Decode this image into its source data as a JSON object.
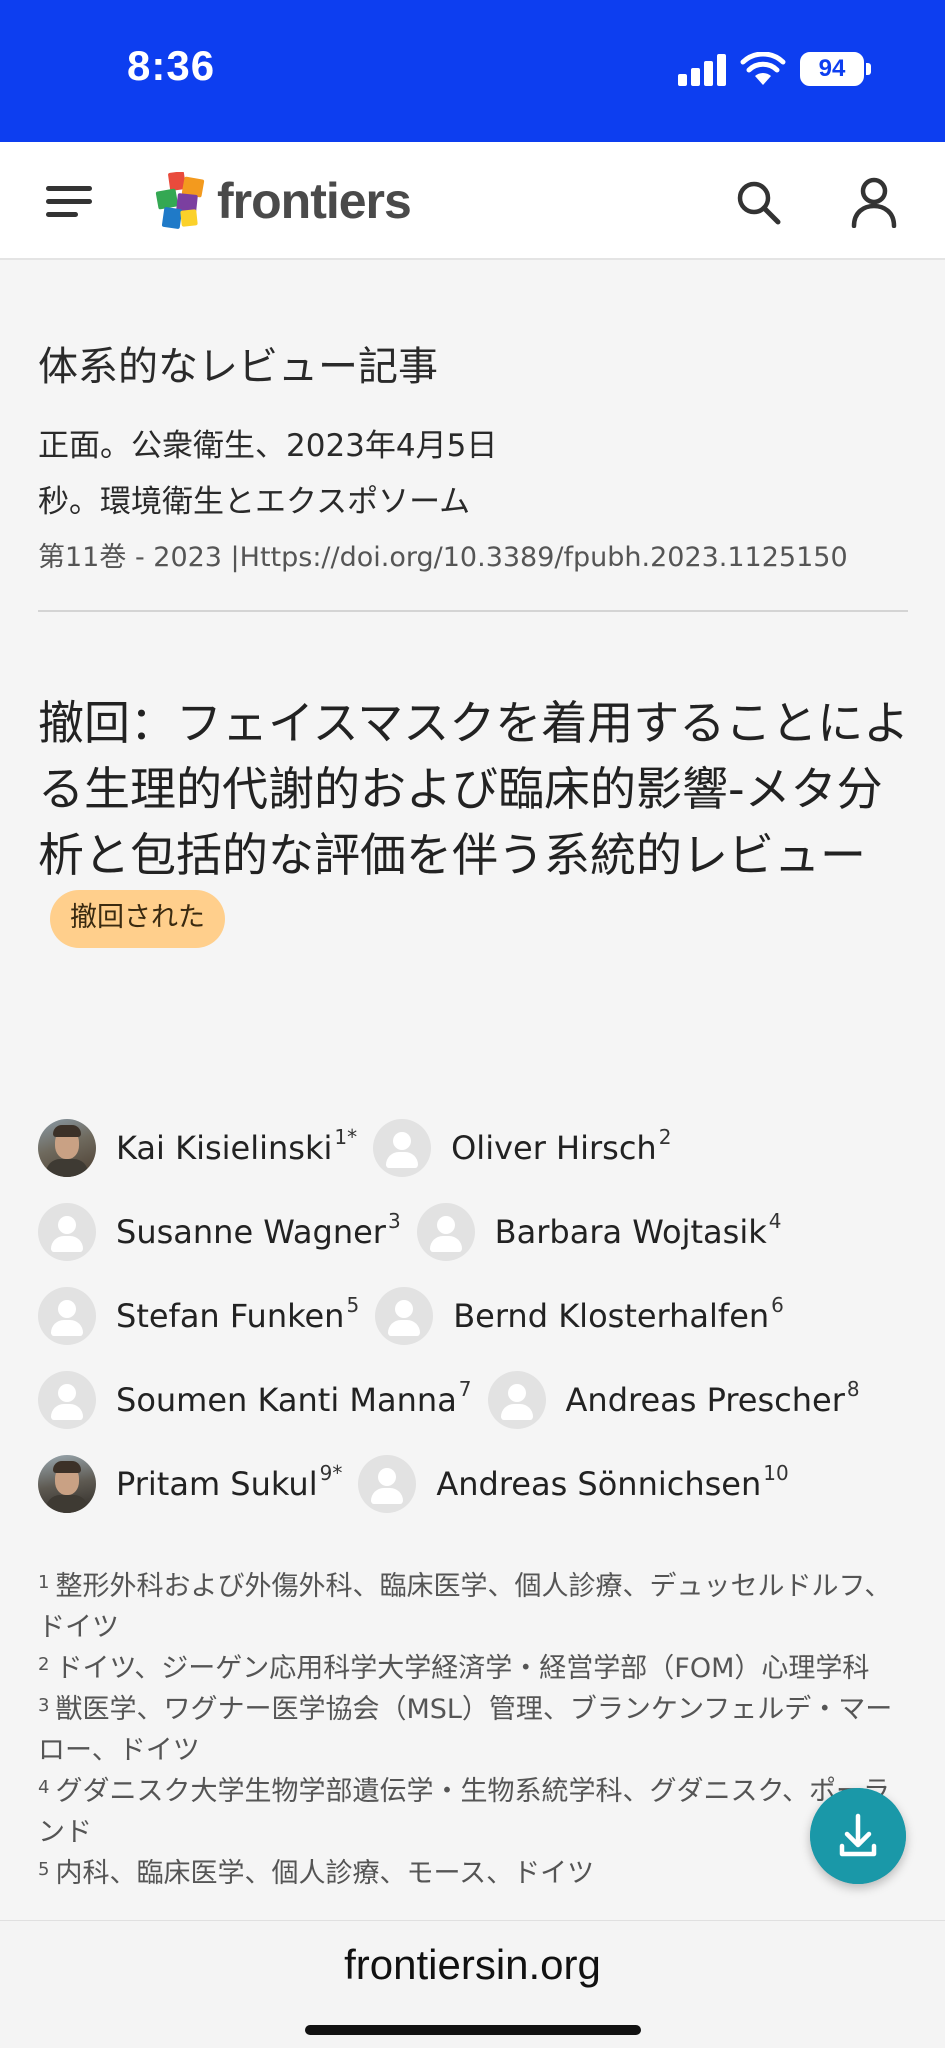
{
  "status_bar": {
    "time": "8:36",
    "battery": "94",
    "signal_icon": "cellular-signal-icon",
    "wifi_icon": "wifi-icon"
  },
  "header": {
    "logo_text": "frontiers",
    "menu_icon": "hamburger-menu-icon",
    "search_icon": "search-icon",
    "account_icon": "user-icon"
  },
  "article": {
    "type": "体系的なレビュー記事",
    "journal_line1": "正面。公衆衛生、2023年4月5日",
    "journal_line2": "秒。環境衛生とエクスポソーム",
    "doi_line": "第11巻 - 2023 |Https://doi.org/10.3389/fpubh.2023.1125150",
    "title": "撤回：フェイスマスクを着用することによる生理的代謝的および臨床的影響-メタ分析と包括的な評価を伴う系統的レビュー",
    "badge": "撤回された"
  },
  "authors": [
    [
      {
        "name": "Kai Kisielinski",
        "sup": "1*",
        "photo": true
      },
      {
        "name": "Oliver Hirsch",
        "sup": "2",
        "photo": false
      }
    ],
    [
      {
        "name": "Susanne Wagner",
        "sup": "3",
        "photo": false
      },
      {
        "name": "Barbara Wojtasik",
        "sup": "4",
        "photo": false
      }
    ],
    [
      {
        "name": "Stefan Funken",
        "sup": "5",
        "photo": false
      },
      {
        "name": "Bernd Klosterhalfen",
        "sup": "6",
        "photo": false
      }
    ],
    [
      {
        "name": "Soumen Kanti Manna",
        "sup": "7",
        "photo": false
      },
      {
        "name": "Andreas Prescher",
        "sup": "8",
        "photo": false
      }
    ],
    [
      {
        "name": "Pritam Sukul",
        "sup": "9*",
        "photo": true
      },
      {
        "name": "Andreas Sönnichsen",
        "sup": "10",
        "photo": false
      }
    ]
  ],
  "affiliations": [
    {
      "num": "1",
      "text": "整形外科および外傷外科、臨床医学、個人診療、デュッセルドルフ、ドイツ"
    },
    {
      "num": "2",
      "text": "ドイツ、ジーゲン応用科学大学経済学・経営学部（FOM）心理学科"
    },
    {
      "num": "3",
      "text": "獣医学、ワグナー医学協会（MSL）管理、ブランケンフェルデ・マーロー、ドイツ"
    },
    {
      "num": "4",
      "text": "グダニスク大学生物学部遺伝学・生物系統学科、グダニスク、ポーランド"
    },
    {
      "num": "5",
      "text": "内科、臨床医学、個人診療、モース、ドイツ"
    }
  ],
  "fab": {
    "icon": "download-icon"
  },
  "url_bar": {
    "url": "frontiersin.org"
  }
}
